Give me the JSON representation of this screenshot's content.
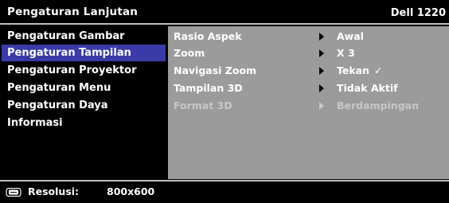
{
  "header": {
    "title": "Pengaturan Lanjutan",
    "model": "Dell 1220"
  },
  "sidebar": {
    "items": [
      {
        "label": "Pengaturan Gambar",
        "active": false
      },
      {
        "label": "Pengaturan Tampilan",
        "active": true
      },
      {
        "label": "Pengaturan Proyektor",
        "active": false
      },
      {
        "label": "Pengaturan Menu",
        "active": false
      },
      {
        "label": "Pengaturan Daya",
        "active": false
      },
      {
        "label": "Informasi",
        "active": false
      }
    ]
  },
  "panel": {
    "rows": [
      {
        "label": "Rasio Aspek",
        "value": "Awal",
        "disabled": false
      },
      {
        "label": "Zoom",
        "value": "X 3",
        "disabled": false
      },
      {
        "label": "Navigasi Zoom",
        "value": "Tekan",
        "check": "✓",
        "disabled": false
      },
      {
        "label": "Tampilan 3D",
        "value": "Tidak Aktif",
        "disabled": false
      },
      {
        "label": "Format 3D",
        "value": "Berdampingan",
        "disabled": true
      }
    ]
  },
  "status": {
    "icon": "monitor-icon",
    "label": "Resolusi:",
    "value": "800x600"
  },
  "colors": {
    "background": "#000000",
    "panel": "#9b9b9b",
    "highlight": "#3a3aa8"
  }
}
